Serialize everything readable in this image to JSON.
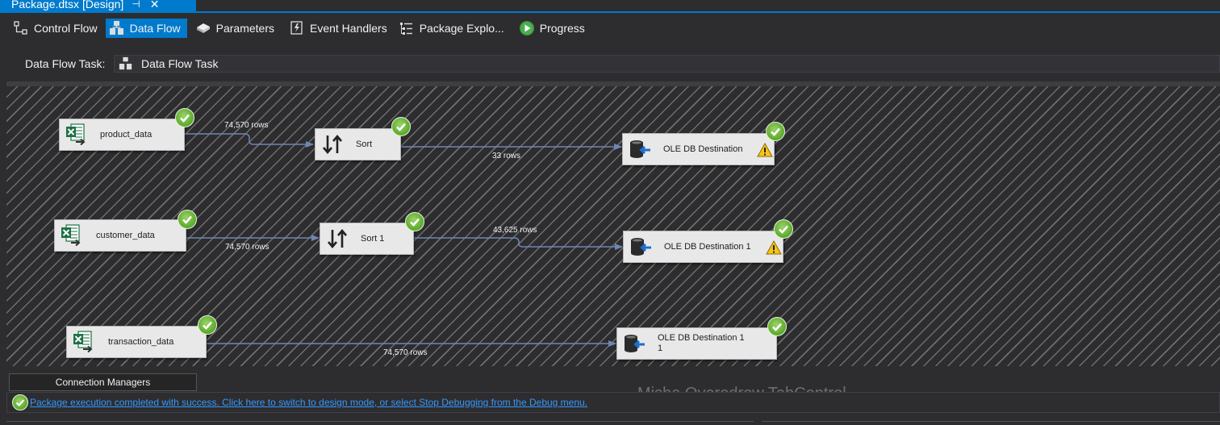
{
  "document_tab": {
    "title": "Package.dtsx [Design]",
    "pin_glyph": "⊣",
    "close_glyph": "✕"
  },
  "designer_tabs": [
    {
      "label": "Control Flow",
      "icon": "control-flow-icon",
      "active": false
    },
    {
      "label": "Data Flow",
      "icon": "data-flow-icon",
      "active": true
    },
    {
      "label": "Parameters",
      "icon": "parameters-icon",
      "active": false
    },
    {
      "label": "Event Handlers",
      "icon": "event-handlers-icon",
      "active": false
    },
    {
      "label": "Package Explo...",
      "icon": "package-explorer-icon",
      "active": false
    },
    {
      "label": "Progress",
      "icon": "play-icon",
      "active": false
    }
  ],
  "task_selector": {
    "label": "Data Flow Task:",
    "value": "Data Flow Task"
  },
  "components": {
    "product_data": {
      "label": "product_data",
      "type": "excel-source",
      "status": "success"
    },
    "sort": {
      "label": "Sort",
      "type": "sort",
      "status": "success"
    },
    "ole_dest": {
      "label": "OLE DB Destination",
      "type": "ole-db-destination",
      "status": "success",
      "warning": true
    },
    "customer_data": {
      "label": "customer_data",
      "type": "excel-source",
      "status": "success"
    },
    "sort1": {
      "label": "Sort 1",
      "type": "sort",
      "status": "success"
    },
    "ole_dest1": {
      "label": "OLE DB Destination 1",
      "type": "ole-db-destination",
      "status": "success",
      "warning": true
    },
    "transaction_data": {
      "label": "transaction_data",
      "type": "excel-source",
      "status": "success"
    },
    "ole_dest11_line1": "OLE DB Destination 1",
    "ole_dest11_line2": "1"
  },
  "paths": {
    "product_to_sort": "74,570 rows",
    "sort_to_dest": "33 rows",
    "sort1_to_dest1": "43,625 rows",
    "customer_to_sort1": "74,570 rows",
    "transaction_to_dest11": "74,570 rows"
  },
  "connection_managers_tab": "Connection Managers",
  "ghost_text": "Misha Overodrow TabControl",
  "status": {
    "message": "Package execution completed with success. Click here to switch to design mode, or select Stop Debugging from the Debug menu."
  },
  "colors": {
    "accent": "#007acc",
    "success": "#5aa82a",
    "warning": "#f5c518",
    "link": "#3399ff",
    "wire": "#6f86b3"
  }
}
